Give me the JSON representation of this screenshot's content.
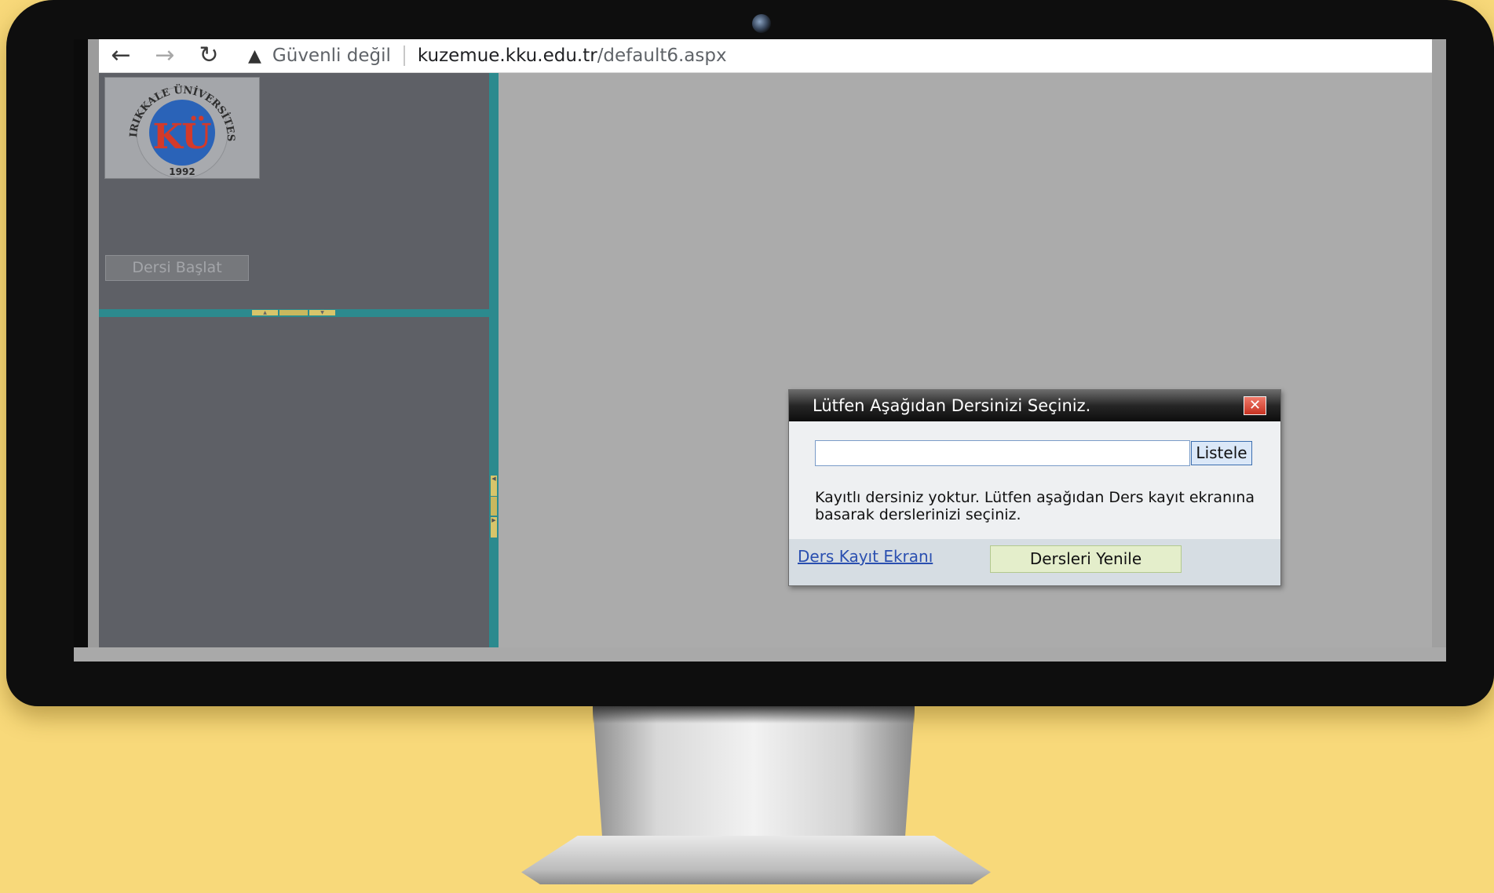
{
  "browser": {
    "security_label": "Güvenli değil",
    "url_host": "kuzemue.kku.edu.tr",
    "url_path": "/default6.aspx"
  },
  "logo": {
    "text_arc": "KIRIKKALE ÜNİVERSİTESİ",
    "initials": "KÜ",
    "year": "1992"
  },
  "left_panel": {
    "start_button": "Dersi Başlat"
  },
  "dialog": {
    "title": "Lütfen Aşağıdan Dersinizi Seçiniz.",
    "search_value": "",
    "list_button": "Listele",
    "message": "Kayıtlı dersiniz yoktur. Lütfen aşağıdan Ders kayıt ekranına basarak derslerinizi seçiniz.",
    "link": "Ders Kayıt Ekranı",
    "refresh_button": "Dersleri Yenile"
  },
  "icons": {
    "back": "arrow-left-icon",
    "forward": "arrow-right-icon",
    "reload": "reload-icon",
    "warning": "warning-triangle-icon",
    "close": "close-icon"
  },
  "colors": {
    "background": "#f8d97a",
    "splitter": "#2c8a8e",
    "panel": "#5e6066",
    "content": "#ababab",
    "dialog_title": "#1a1a1a",
    "close_button": "#d9412e",
    "link": "#2a4fb0",
    "refresh_button": "#e4eecb"
  }
}
